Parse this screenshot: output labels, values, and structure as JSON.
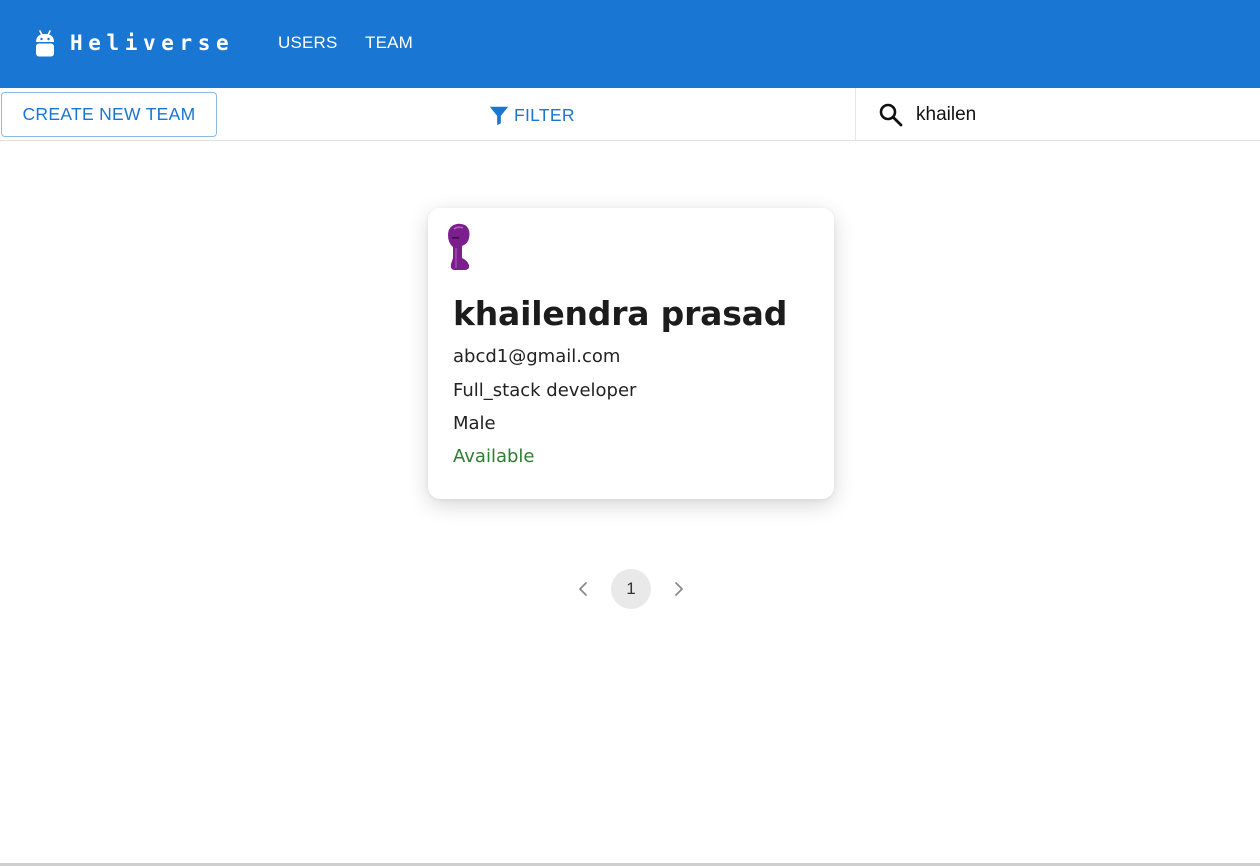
{
  "header": {
    "brand": "Heliverse",
    "nav": [
      "USERS",
      "TEAM"
    ],
    "logo_icon": "android-icon"
  },
  "toolbar": {
    "create_team_label": "CREATE NEW TEAM",
    "filter_label": "FILTER",
    "filter_icon": "filter-funnel-icon",
    "search_icon": "search-icon",
    "search_value": "khailen"
  },
  "users": [
    {
      "name": "khailendra prasad",
      "email": "abcd1@gmail.com",
      "domain": "Full_stack developer",
      "gender": "Male",
      "availability": "Available"
    }
  ],
  "pagination": {
    "current_page": "1",
    "prev_icon": "chevron-left-icon",
    "next_icon": "chevron-right-icon"
  },
  "colors": {
    "primary": "#1976d2",
    "available": "#2e7d32",
    "avatar": "#7b1f8c"
  }
}
